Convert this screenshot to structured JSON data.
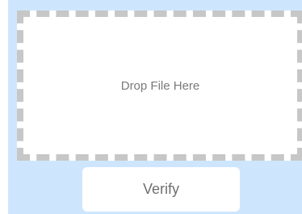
{
  "dropzone": {
    "label": "Drop File Here"
  },
  "actions": {
    "verify_label": "Verify"
  },
  "colors": {
    "panel_background": "#cde6fe",
    "dropzone_border": "#c7c7c7",
    "text": "#7a7a7a"
  }
}
